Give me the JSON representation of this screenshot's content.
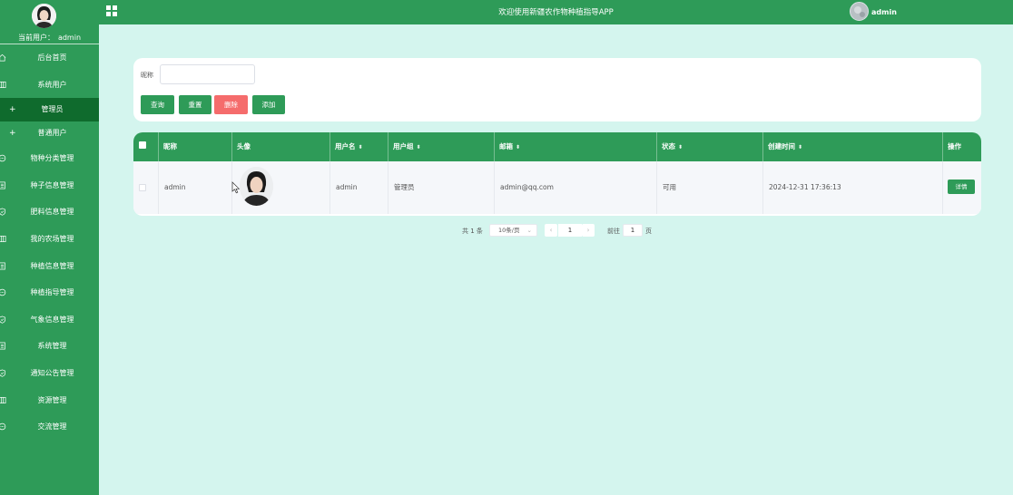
{
  "topbar": {
    "app_title": "欢迎使用新疆农作物种植指导APP",
    "username": "admin"
  },
  "sidebar": {
    "current_user_label": "当前用户：",
    "current_user_name": "admin",
    "items": [
      {
        "label": "后台首页",
        "icon": "home-icon"
      },
      {
        "label": "系统用户",
        "icon": "table-icon"
      },
      {
        "label": "管理员",
        "icon": "plus-icon",
        "sub": true,
        "active": true
      },
      {
        "label": "普通用户",
        "icon": "plus-icon",
        "sub": true
      },
      {
        "label": "物种分类管理",
        "icon": "chat-icon"
      },
      {
        "label": "种子信息管理",
        "icon": "document-icon"
      },
      {
        "label": "肥料信息管理",
        "icon": "shield-icon"
      },
      {
        "label": "我的农场管理",
        "icon": "table-icon"
      },
      {
        "label": "种植信息管理",
        "icon": "document-icon"
      },
      {
        "label": "种植指导管理",
        "icon": "chat-icon"
      },
      {
        "label": "气象信息管理",
        "icon": "shield-icon"
      },
      {
        "label": "系统管理",
        "icon": "document-icon"
      },
      {
        "label": "通知公告管理",
        "icon": "shield-icon"
      },
      {
        "label": "资源管理",
        "icon": "table-icon"
      },
      {
        "label": "交流管理",
        "icon": "chat-icon"
      }
    ]
  },
  "search": {
    "label": "昵称",
    "value": "",
    "placeholder": "",
    "buttons": {
      "query": "查询",
      "reset": "重置",
      "delete": "删除",
      "add": "添加"
    }
  },
  "table": {
    "columns": [
      "昵称",
      "头像",
      "用户名",
      "用户组",
      "邮箱",
      "状态",
      "创建时间",
      "操作"
    ],
    "rows": [
      {
        "nickname": "admin",
        "username": "admin",
        "group": "管理员",
        "email": "admin@qq.com",
        "status": "可用",
        "created": "2024-12-31 17:36:13",
        "action": "详情"
      }
    ]
  },
  "pagination": {
    "total": "共 1 条",
    "page_size": "10条/页",
    "current_page": "1",
    "goto_label": "前往",
    "goto_value": "1",
    "page_suffix": "页"
  },
  "colors": {
    "primary": "#2e9b58",
    "primary_dark": "#0f6b2d",
    "danger": "#f56c6c",
    "background": "#d4f5ee"
  }
}
